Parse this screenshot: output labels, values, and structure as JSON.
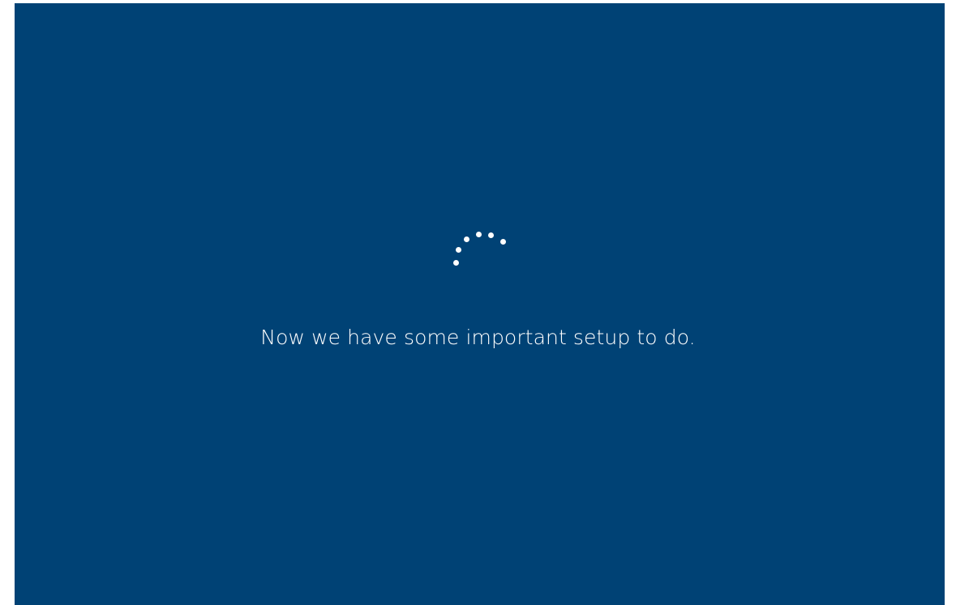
{
  "screen": {
    "message": "Now we have some important setup to do.",
    "background_color": "#004275",
    "text_color": "#ffffff"
  },
  "spinner": {
    "icon": "loading-spinner-icon",
    "dot_count": 6,
    "dot_color": "#ffffff"
  }
}
